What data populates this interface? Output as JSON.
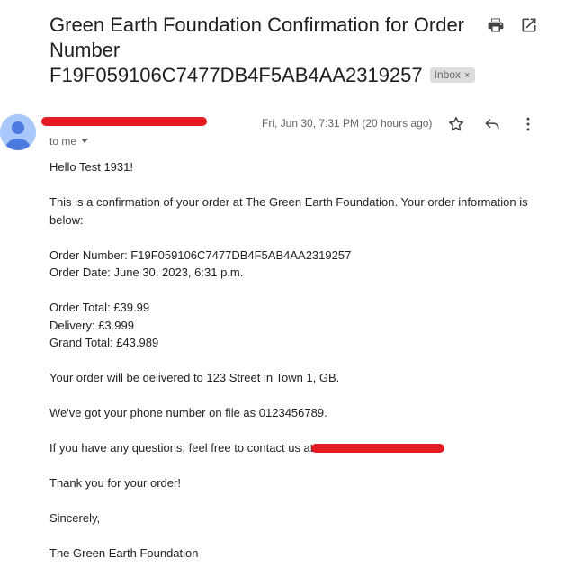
{
  "email": {
    "subject": "Green Earth Foundation Confirmation for Order Number F19F059106C7477DB4F5AB4AA2319257",
    "label": "Inbox",
    "label_close": "×",
    "to": "to me",
    "date": "Fri, Jun 30, 7:31 PM (20 hours ago)"
  },
  "body": {
    "greeting": "Hello Test 1931!",
    "intro": "This is a confirmation of your order at The Green Earth Foundation. Your order information is below:",
    "order_number": "Order Number: F19F059106C7477DB4F5AB4AA2319257",
    "order_date": "Order Date: June 30, 2023, 6:31 p.m.",
    "order_total": "Order Total: £39.99",
    "delivery": "Delivery: £3.999",
    "grand_total": "Grand Total: £43.989",
    "delivery_address": "Your order will be delivered to 123 Street in Town 1, GB.",
    "phone": "We've got your phone number on file as 0123456789.",
    "questions": "If you have any questions, feel free to contact us at",
    "thanks": "Thank you for your order!",
    "closing": "Sincerely,",
    "signature": "The Green Earth Foundation"
  },
  "icons": {
    "print": "print-icon",
    "open_new_window": "open-in-new-window-icon",
    "star": "star-icon",
    "reply": "reply-icon",
    "more": "more-vert-icon",
    "avatar": "default-avatar-icon",
    "redaction_color": "#e31b23"
  }
}
